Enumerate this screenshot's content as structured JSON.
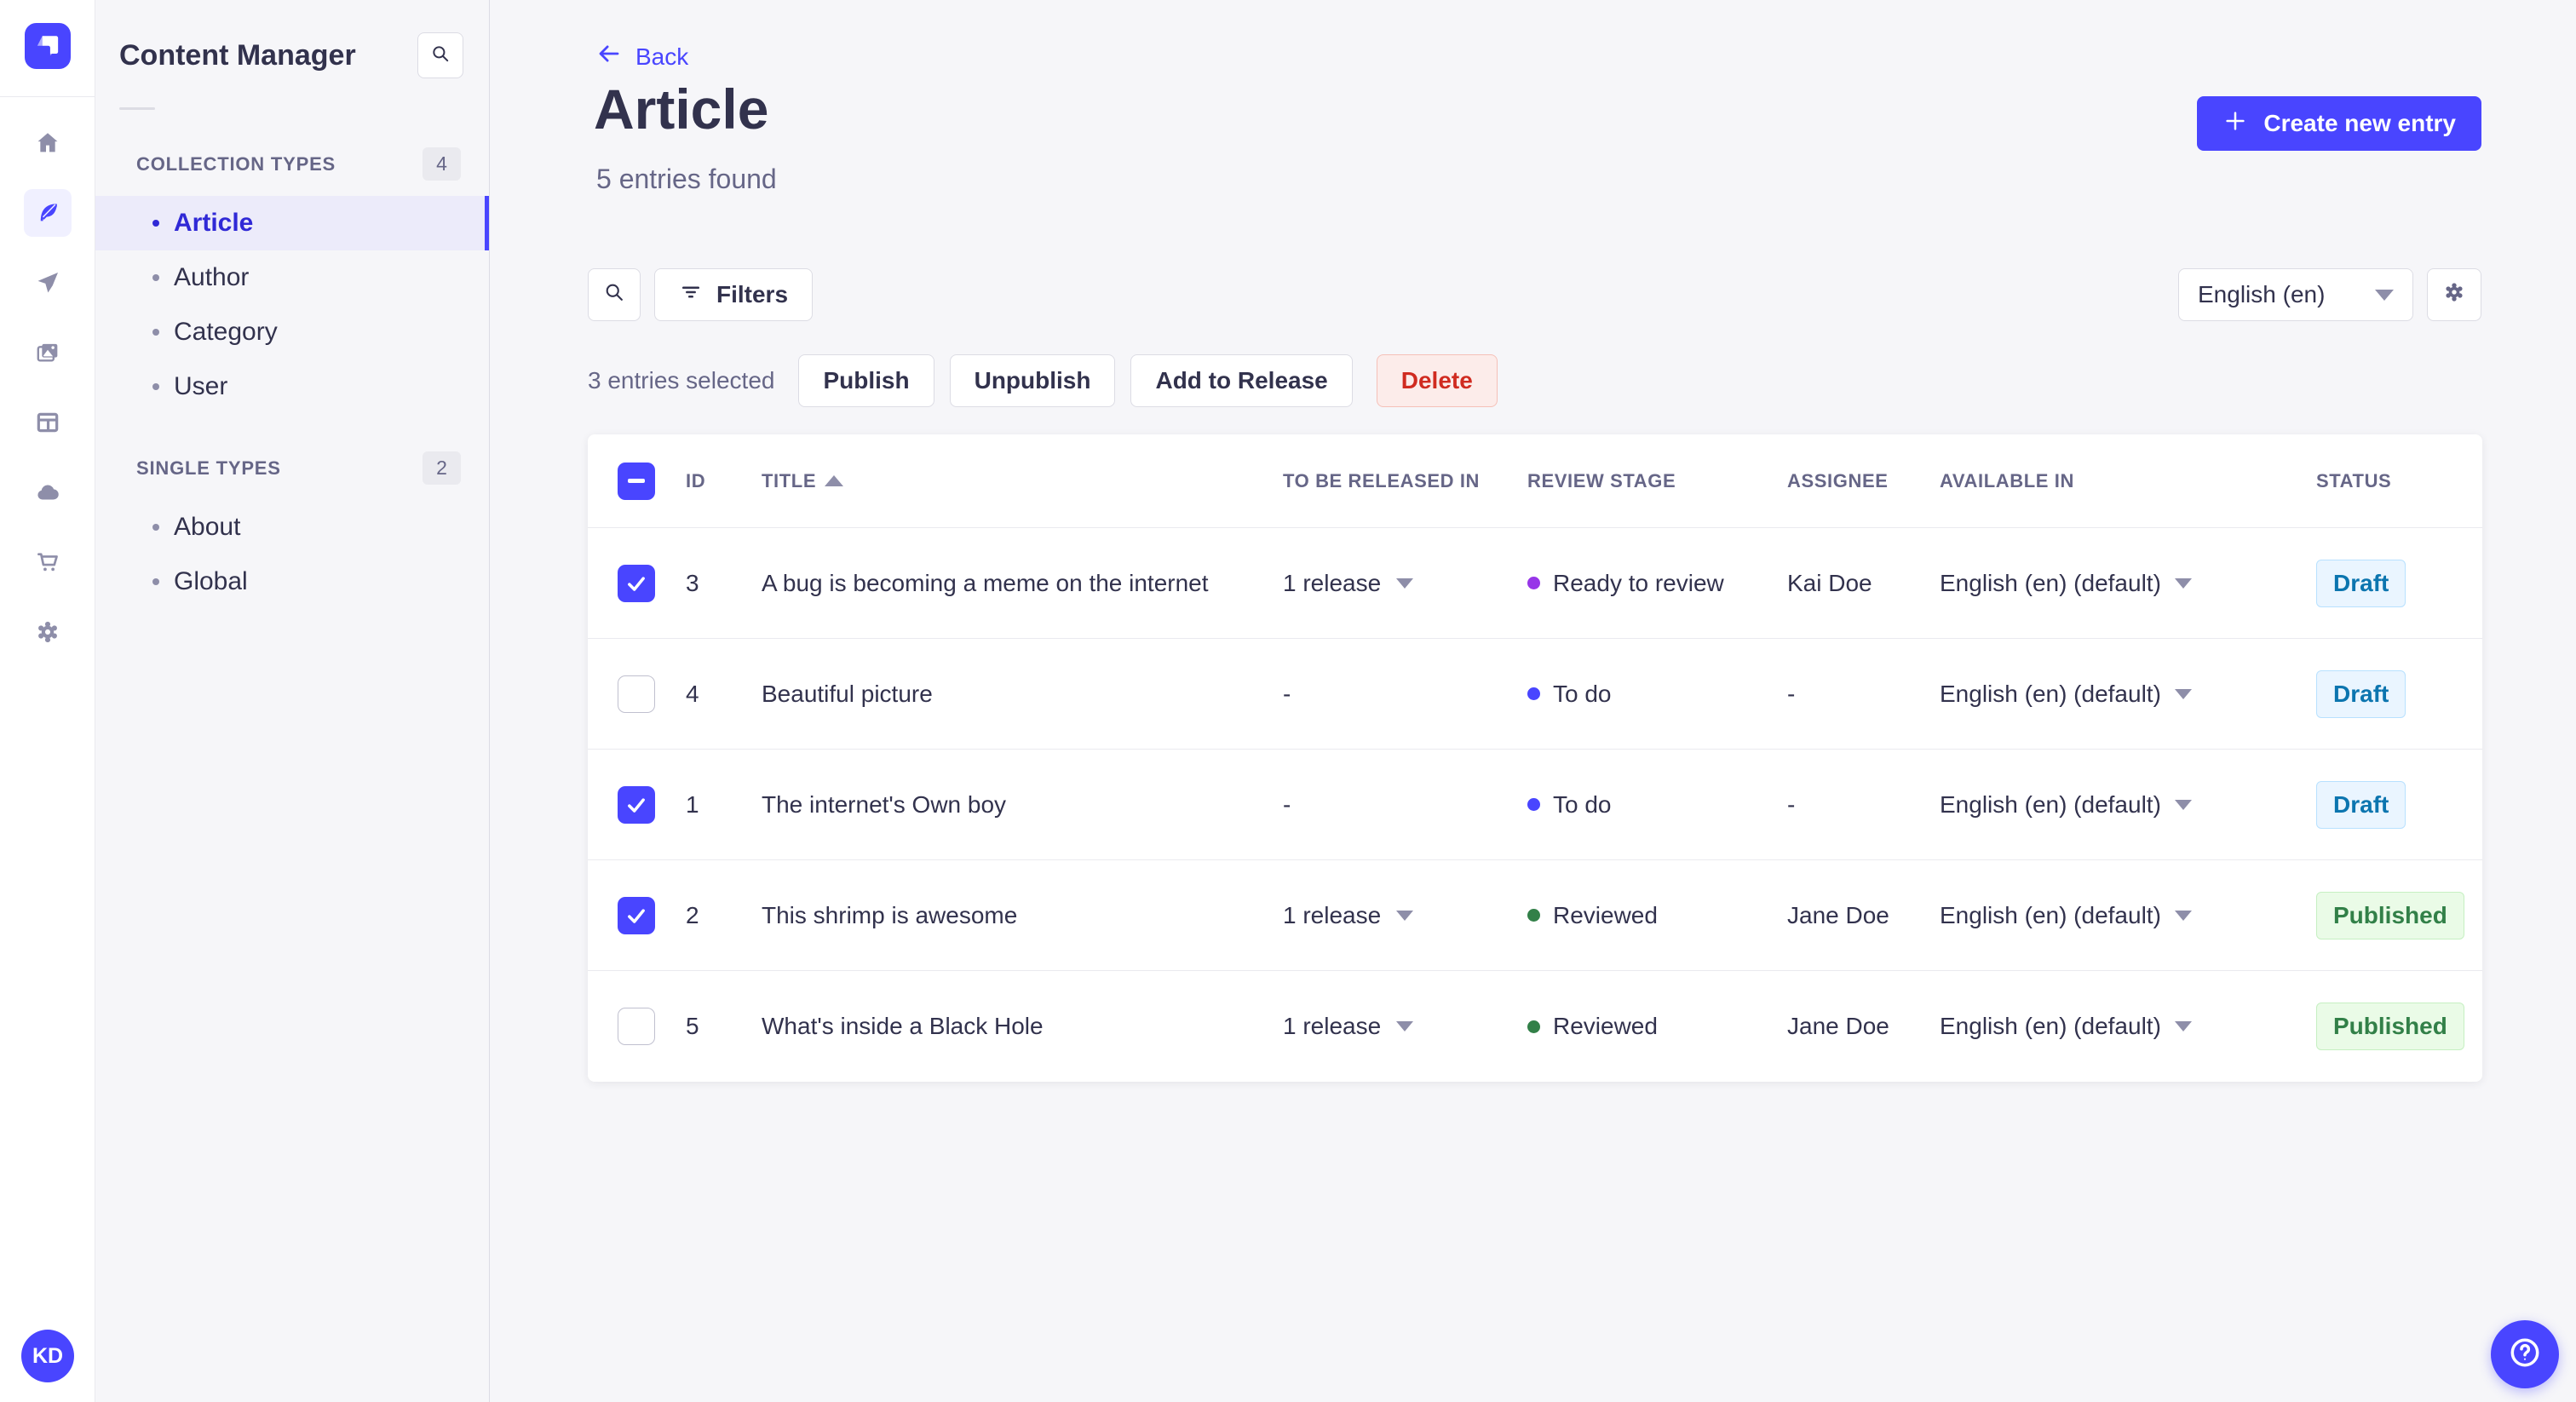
{
  "app": {
    "name": "Strapi",
    "brand_color": "#4945FF"
  },
  "rail": {
    "icons": [
      "strapi-logo",
      "home",
      "content-manager",
      "releases",
      "media-library",
      "content-type-builder",
      "cloud",
      "marketplace",
      "settings"
    ],
    "active_icon": "content-manager",
    "avatar_initials": "KD"
  },
  "subnav": {
    "title": "Content Manager",
    "search_icon": "search",
    "sections": [
      {
        "label": "COLLECTION TYPES",
        "badge": "4",
        "items": [
          {
            "label": "Article",
            "active": true
          },
          {
            "label": "Author",
            "active": false
          },
          {
            "label": "Category",
            "active": false
          },
          {
            "label": "User",
            "active": false
          }
        ]
      },
      {
        "label": "SINGLE TYPES",
        "badge": "2",
        "items": [
          {
            "label": "About",
            "active": false
          },
          {
            "label": "Global",
            "active": false
          }
        ]
      }
    ]
  },
  "header": {
    "back_label": "Back",
    "title": "Article",
    "subtitle": "5 entries found",
    "create_button_label": "Create new entry"
  },
  "toolbar": {
    "search_icon": "search",
    "filters_label": "Filters",
    "locale_selected": "English (en)",
    "settings_icon": "gear"
  },
  "selection": {
    "summary": "3 entries selected",
    "publish_label": "Publish",
    "unpublish_label": "Unpublish",
    "add_to_release_label": "Add to Release",
    "delete_label": "Delete"
  },
  "table": {
    "columns": [
      "ID",
      "TITLE",
      "TO BE RELEASED IN",
      "REVIEW STAGE",
      "ASSIGNEE",
      "AVAILABLE IN",
      "STATUS"
    ],
    "sorted_column": "TITLE",
    "sort_direction": "asc",
    "header_checkbox": "indeterminate",
    "rows": [
      {
        "selected": true,
        "id": "3",
        "title": "A bug is becoming a meme on the internet",
        "to_be_released_in": "1 release",
        "release_menu": true,
        "review_stage": "Ready to review",
        "stage_color": "#9736E8",
        "assignee": "Kai Doe",
        "available_in": "English (en) (default)",
        "status": "Draft"
      },
      {
        "selected": false,
        "id": "4",
        "title": "Beautiful picture",
        "to_be_released_in": "-",
        "release_menu": false,
        "review_stage": "To do",
        "stage_color": "#4945FF",
        "assignee": "-",
        "available_in": "English (en) (default)",
        "status": "Draft"
      },
      {
        "selected": true,
        "id": "1",
        "title": "The internet's Own boy",
        "to_be_released_in": "-",
        "release_menu": false,
        "review_stage": "To do",
        "stage_color": "#4945FF",
        "assignee": "-",
        "available_in": "English (en) (default)",
        "status": "Draft"
      },
      {
        "selected": true,
        "id": "2",
        "title": "This shrimp is awesome",
        "to_be_released_in": "1 release",
        "release_menu": true,
        "review_stage": "Reviewed",
        "stage_color": "#328048",
        "assignee": "Jane Doe",
        "available_in": "English (en) (default)",
        "status": "Published"
      },
      {
        "selected": false,
        "id": "5",
        "title": "What's inside a Black Hole",
        "to_be_released_in": "1 release",
        "release_menu": true,
        "review_stage": "Reviewed",
        "stage_color": "#328048",
        "assignee": "Jane Doe",
        "available_in": "English (en) (default)",
        "status": "Published"
      }
    ]
  },
  "status_colors": {
    "draft": {
      "bg": "#EAF5FF",
      "border": "#B8E1FF",
      "text": "#0C75AF"
    },
    "published": {
      "bg": "#EAFBE7",
      "border": "#C6F0C2",
      "text": "#328048"
    }
  },
  "help_button": {
    "icon": "question-circle"
  }
}
